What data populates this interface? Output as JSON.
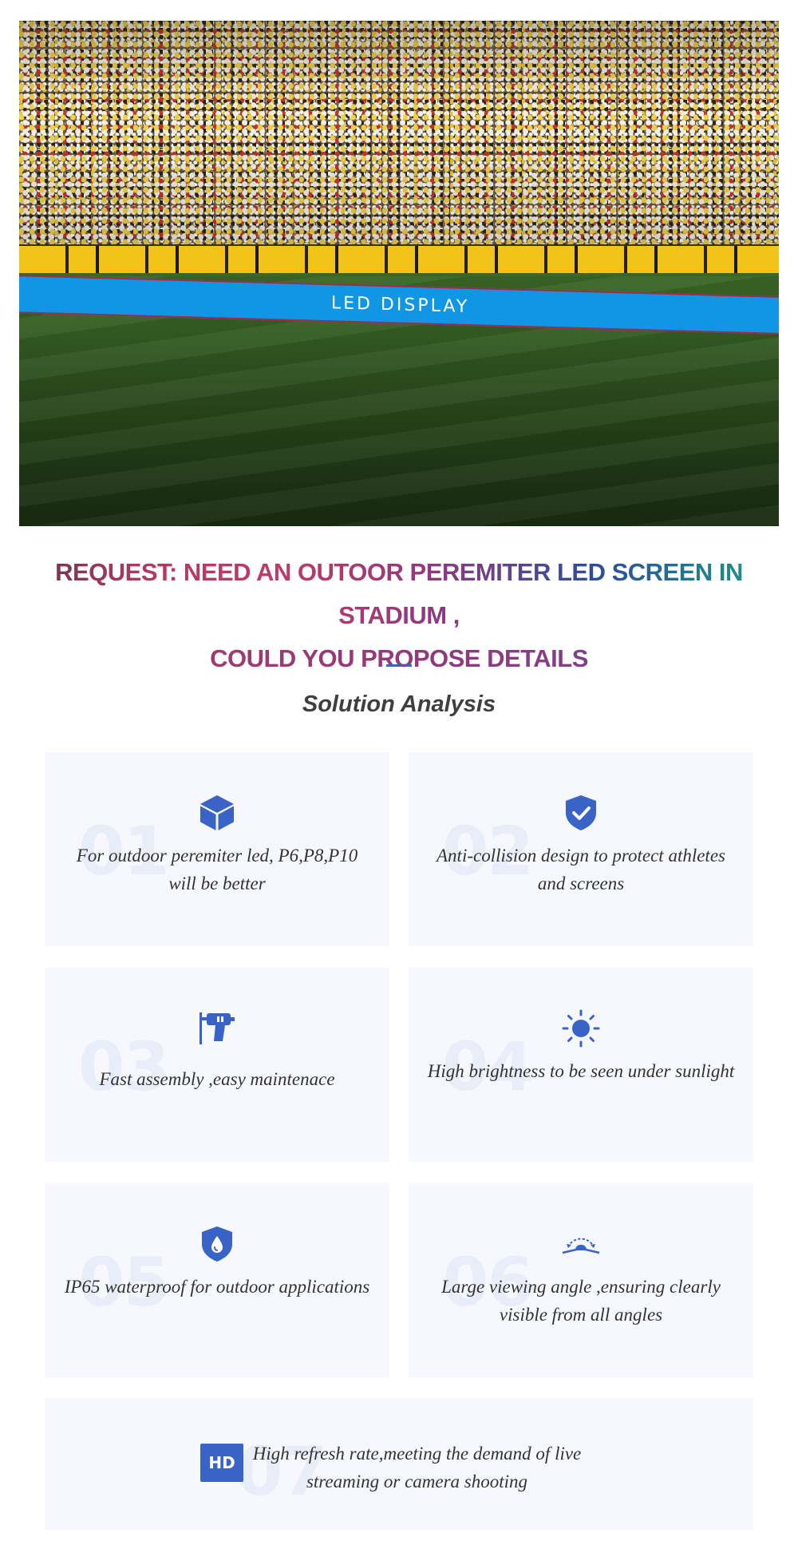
{
  "hero": {
    "banner_text": "LED DISPLAY"
  },
  "headline": {
    "line1": "REQUEST: NEED AN OUTOOR PEREMITER LED SCREEN IN STADIUM ,",
    "line2": "COULD YOU PROPOSE DETAILS"
  },
  "section": {
    "subtitle": "Solution Analysis"
  },
  "cards": [
    {
      "number": "01",
      "icon": "cube-icon",
      "text": "For outdoor peremiter led, P6,P8,P10 will be better"
    },
    {
      "number": "02",
      "icon": "shield-check-icon",
      "text": "Anti-collision design to protect athletes and screens"
    },
    {
      "number": "03",
      "icon": "drill-icon",
      "text": "Fast assembly ,easy maintenace"
    },
    {
      "number": "04",
      "icon": "sun-icon",
      "text": "High brightness to be seen under sunlight"
    },
    {
      "number": "05",
      "icon": "water-drop-shield-icon",
      "text": "IP65 waterproof for outdoor applications"
    },
    {
      "number": "06",
      "icon": "viewing-angle-icon",
      "text": "Large viewing angle ,ensuring clearly visible from all angles"
    },
    {
      "number": "07",
      "icon": "hd-icon",
      "icon_label": "HD",
      "text": "High refresh rate,meeting the demand of live streaming or camera shooting"
    }
  ],
  "colors": {
    "accent": "#3a63c8",
    "card_background": "#f6f8fd",
    "banner": "#1196e6"
  }
}
